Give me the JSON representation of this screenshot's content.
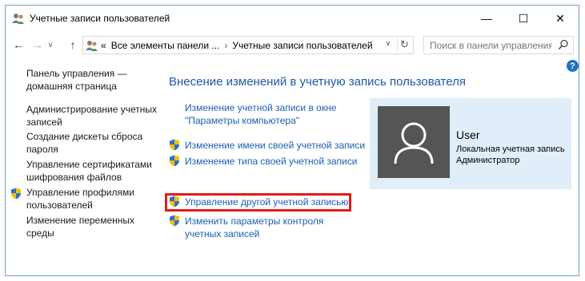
{
  "window": {
    "title": "Учетные записи пользователей",
    "minimize": "—",
    "maximize": "☐",
    "close": "✕"
  },
  "address_bar": {
    "overflow": "«",
    "crumbs": [
      "Все элементы панели ...",
      "Учетные записи пользователей"
    ],
    "separator": "›",
    "search_placeholder": "Поиск в панели управления"
  },
  "left_nav": [
    {
      "label": "Панель управления — домашняя страница",
      "shield": false
    },
    {
      "label": "Администрирование учетных записей",
      "shield": false
    },
    {
      "label": "Создание дискеты сброса пароля",
      "shield": false
    },
    {
      "label": "Управление сертификатами шифрования файлов",
      "shield": false
    },
    {
      "label": "Управление профилями пользователей",
      "shield": true
    },
    {
      "label": "Изменение переменных среды",
      "shield": false
    }
  ],
  "main": {
    "heading": "Внесение изменений в учетную запись пользователя",
    "tasks": [
      {
        "label": "Изменение учетной записи в окне \"Параметры компьютера\"",
        "shield": false
      },
      {
        "label": "Изменение имени своей учетной записи",
        "shield": true
      },
      {
        "label": "Изменение типа своей учетной записи",
        "shield": true
      },
      {
        "label": "Управление другой учетной записью",
        "shield": true,
        "highlighted": true
      },
      {
        "label": "Изменить параметры контроля учетных записей",
        "shield": true
      }
    ]
  },
  "user": {
    "name": "User",
    "account_type": "Локальная учетная запись",
    "role": "Администратор"
  },
  "help_label": "?",
  "colors": {
    "link": "#1a5fb4",
    "heading": "#1e5aa8",
    "user_card_bg": "#e1eef9",
    "avatar_bg": "#555555",
    "highlight": "#e01b1b"
  }
}
